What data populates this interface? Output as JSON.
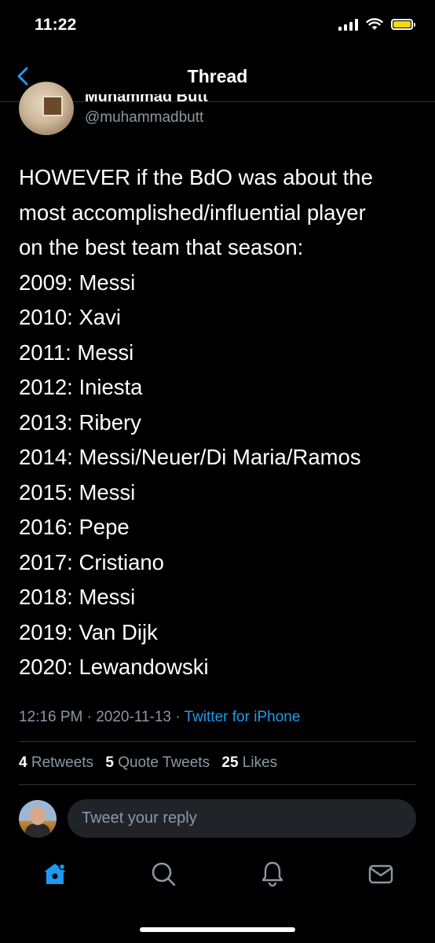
{
  "status_bar": {
    "time": "11:22"
  },
  "nav": {
    "title": "Thread"
  },
  "tweet": {
    "author_name": "Muhammad Butt",
    "author_handle": "@muhammadbutt",
    "lines": [
      "HOWEVER if the BdO was about the",
      "most accomplished/influential player",
      "on the best team that season:",
      "2009: Messi",
      "2010: Xavi",
      "2011: Messi",
      "2012: Iniesta",
      "2013: Ribery",
      "2014: Messi/Neuer/Di Maria/Ramos",
      "2015: Messi",
      "2016: Pepe",
      "2017: Cristiano",
      "2018: Messi",
      "2019: Van Dijk",
      "2020: Lewandowski"
    ],
    "time": "12:16 PM",
    "date": "2020-11-13",
    "separator": " · ",
    "source": "Twitter for iPhone",
    "stats": {
      "retweets_count": "4",
      "retweets_label": "Retweets",
      "quotes_count": "5",
      "quotes_label": "Quote Tweets",
      "likes_count": "25",
      "likes_label": "Likes"
    }
  },
  "reply": {
    "placeholder": "Tweet your reply"
  },
  "tab_bar": {
    "icons": [
      "home-icon",
      "search-icon",
      "notifications-icon",
      "messages-icon"
    ],
    "active_color": "#1d9bf0",
    "inactive_color": "#8b98a5"
  },
  "colors": {
    "accent": "#1d9bf0",
    "secondary_text": "#8b98a5",
    "battery": "#ffd60a"
  }
}
